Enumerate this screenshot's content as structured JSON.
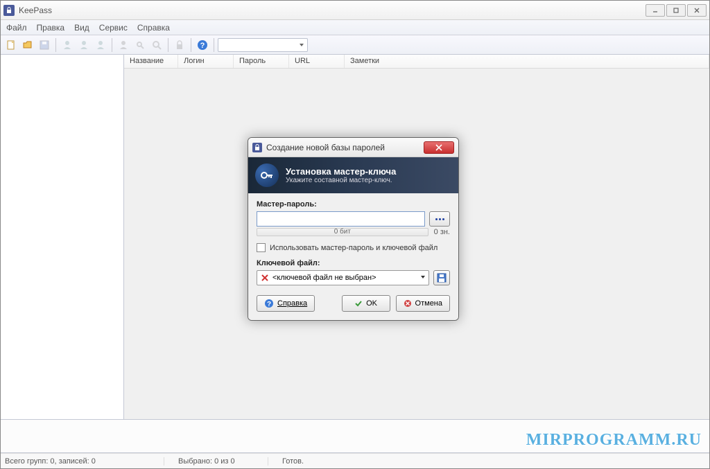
{
  "window": {
    "title": "KeePass"
  },
  "menu": {
    "file": "Файл",
    "edit": "Правка",
    "view": "Вид",
    "tools": "Сервис",
    "help": "Справка"
  },
  "columns": {
    "name": "Название",
    "login": "Логин",
    "password": "Пароль",
    "url": "URL",
    "notes": "Заметки"
  },
  "status": {
    "groups": "Всего групп: 0, записей: 0",
    "selected": "Выбрано: 0 из 0",
    "ready": "Готов."
  },
  "dialog": {
    "title": "Создание новой базы паролей",
    "banner_title": "Установка мастер-ключа",
    "banner_sub": "Укажите составной мастер-ключ.",
    "master_label": "Мастер-пароль:",
    "bits": "0 бит",
    "chars": "0 зн.",
    "use_keyfile": "Использовать мастер-пароль и ключевой файл",
    "keyfile_label": "Ключевой файл:",
    "keyfile_placeholder": "<ключевой файл не выбран>",
    "help": "Справка",
    "ok": "OK",
    "cancel": "Отмена"
  },
  "watermark": "MIRPROGRAMM.RU"
}
